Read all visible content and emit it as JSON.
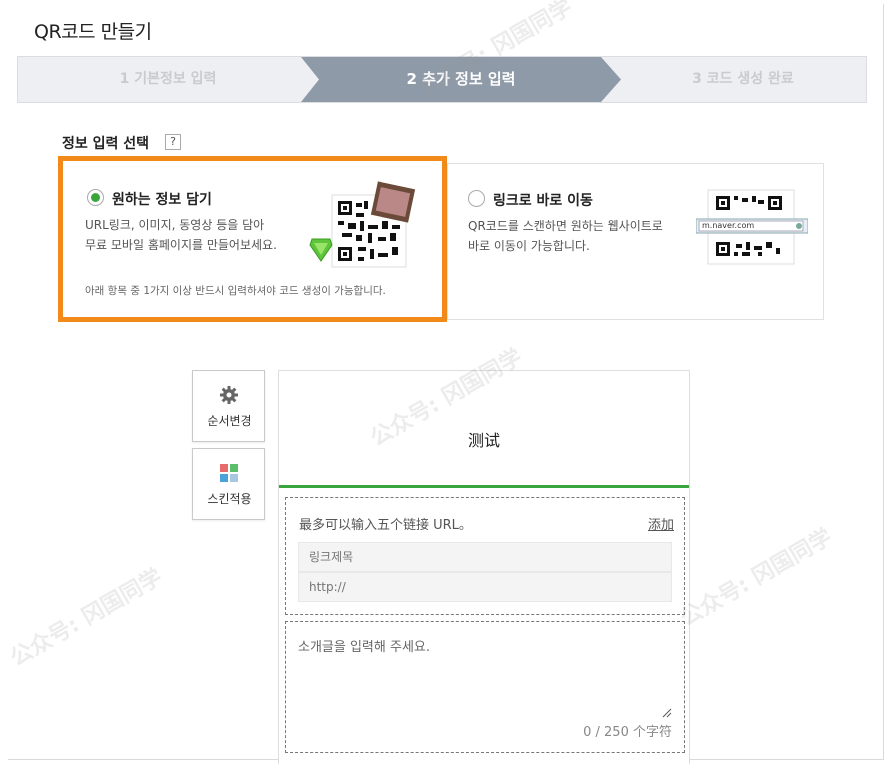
{
  "page": {
    "title": "QR코드 만들기"
  },
  "steps": [
    {
      "label": "1 기본정보 입력",
      "state": "done"
    },
    {
      "label": "2 추가 정보 입력",
      "state": "active"
    },
    {
      "label": "3 코드 생성 완료",
      "state": "pending"
    }
  ],
  "section": {
    "label": "정보 입력 선택",
    "help": "?"
  },
  "option_info": {
    "title": "원하는 정보 담기",
    "desc_line1": "URL링크, 이미지, 동영상 등을 담아",
    "desc_line2": "무료 모바일 홈페이지를 만들어보세요.",
    "note": "아래 항목 중 1가지 이상 반드시 입력하셔야 코드 생성이 가능합니다.",
    "selected": true
  },
  "option_link": {
    "title": "링크로 바로 이동",
    "desc_line1": "QR코드를 스캔하면 원하는 웹사이트로",
    "desc_line2": "바로 이동이 가능합니다.",
    "url_sample": "m.naver.com",
    "selected": false
  },
  "side": {
    "reorder_label": "순서변경",
    "skin_label": "스킨적용"
  },
  "panel": {
    "title": "测试",
    "link_hint": "最多可以输入五个链接 URL。",
    "add_label": "添加",
    "link_title_placeholder": "링크제목",
    "link_url_placeholder": "http://",
    "intro_placeholder": "소개글을 입력해 주세요.",
    "counter": "0 / 250 个字符"
  },
  "watermark": "公众号: 冈国同学",
  "colors": {
    "accent_orange": "#f28a1a",
    "accent_green": "#3aa53c",
    "step_active": "#8f9aa8"
  }
}
